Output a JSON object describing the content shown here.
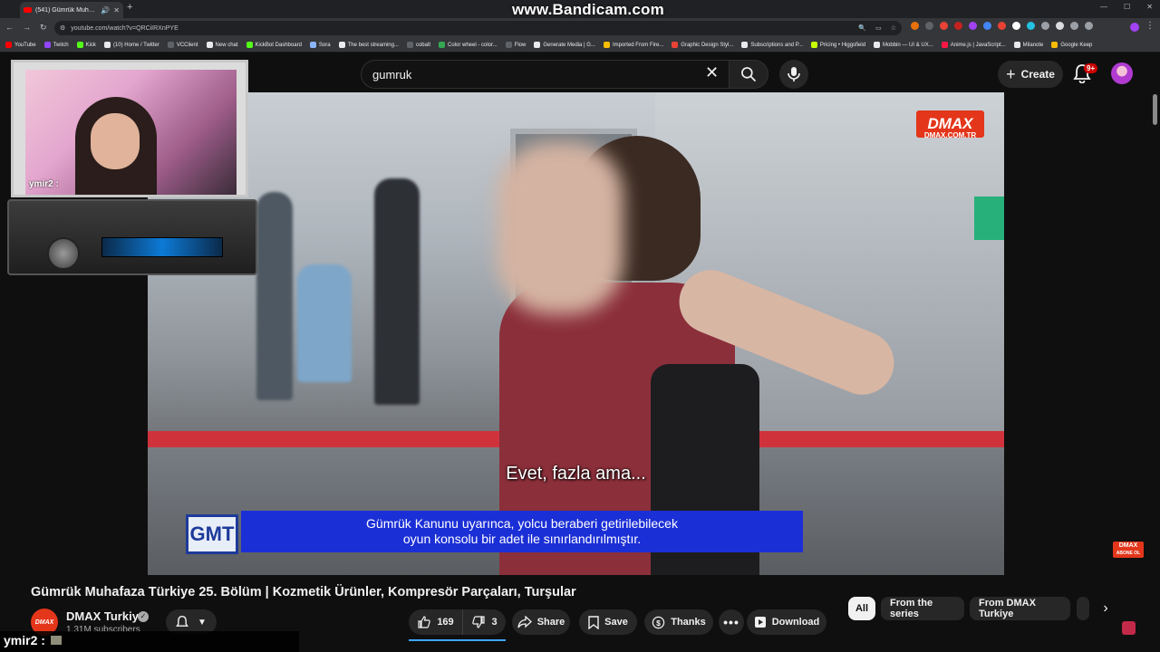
{
  "browser": {
    "tab_title": "(541) Gümrük Muhafaza Tü",
    "url": "youtube.com/watch?v=QRCiIRXnPYE",
    "watermark": "www.Bandicam.com",
    "bookmarks": [
      "YouTube",
      "Twitch",
      "Kick",
      "(10) Home / Twitter",
      "VCClient",
      "New chat",
      "KickBot Dashboard",
      "Sora",
      "The best streaming...",
      "cobalt",
      "Color wheel - color...",
      "Flow",
      "Generate Media | G...",
      "Imported From Fire...",
      "Graphic Design Styl...",
      "Subscriptions and P...",
      "Pricing • Higgsfield",
      "Mobbin — UI & UX...",
      "Anime.js | JavaScript...",
      "Milanote",
      "Google Keep"
    ]
  },
  "header": {
    "search_query": "gumruk",
    "create_label": "Create",
    "notification_count": "9+"
  },
  "video": {
    "watermark_brand": "DMAX",
    "watermark_url": "DMAX.COM.TR",
    "subtitle": "Evet, fazla ama...",
    "info_badge": "GMT",
    "info_caption_line1": "Gümrük Kanunu uyarınca, yolcu beraberi getirilebilecek",
    "info_caption_line2": "oyun konsolu bir adet ile sınırlandırılmıştır.",
    "corner_logo_line1": "DMAX",
    "corner_logo_line2": "ABONE OL"
  },
  "webcam": {
    "overlay_label": "ymir2 :"
  },
  "meta": {
    "title": "Gümrük Muhafaza Türkiye 25. Bölüm | Kozmetik Ürünler, Kompresör Parçaları, Turşular",
    "channel_avatar_text": "DMAX",
    "channel_name": "DMAX Turkiye",
    "subscribers": "1.31M subscribers",
    "likes": "169",
    "dislikes": "3",
    "share_label": "Share",
    "save_label": "Save",
    "thanks_label": "Thanks",
    "download_label": "Download"
  },
  "chips": {
    "all": "All",
    "series": "From the series",
    "channel": "From DMAX Turkiye"
  },
  "chat": {
    "line": "ymir2 :"
  },
  "colors": {
    "background": "#0f0f0f",
    "brand_red": "#e3361b",
    "caption_blue": "#1b2fd6",
    "like_underline": "#3ea6ff"
  }
}
